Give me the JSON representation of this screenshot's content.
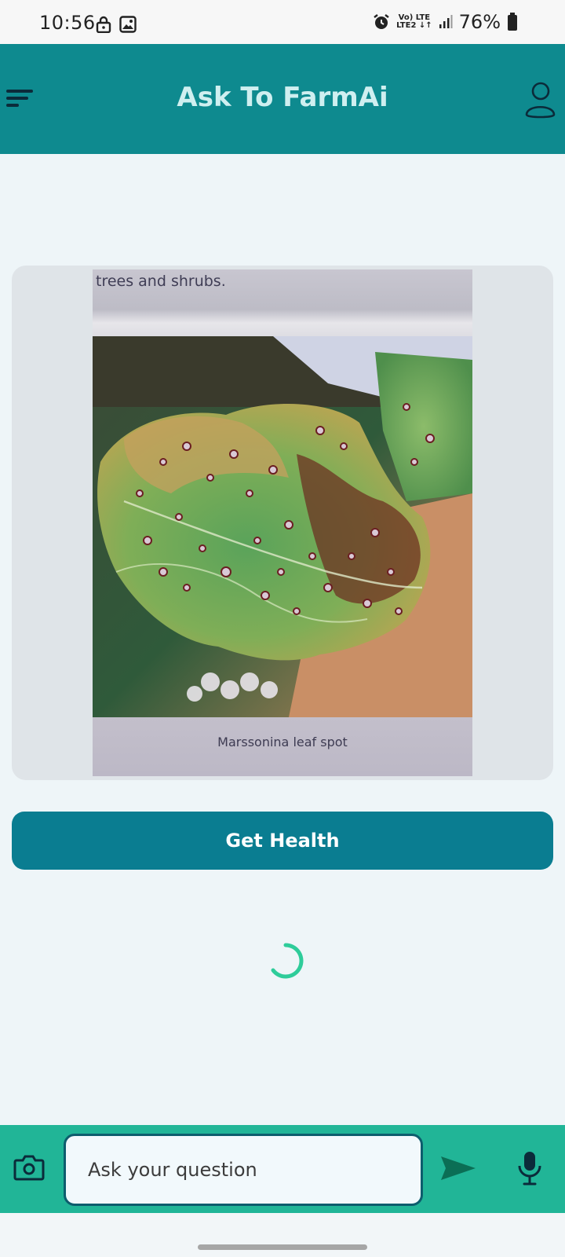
{
  "status_bar": {
    "time": "10:56",
    "network_top": "Vo) LTE",
    "network_bottom": "LTE2 ↓↑",
    "battery": "76%",
    "icons": [
      "lock-icon",
      "image-icon",
      "alarm-icon",
      "signal-icon",
      "battery-icon"
    ]
  },
  "app_bar": {
    "title": "Ask To FarmAi",
    "menu_icon": "menu-icon",
    "profile_icon": "person-icon"
  },
  "image_card": {
    "photo_top_text": "trees and shrubs.",
    "photo_caption": "Marssonina leaf spot"
  },
  "actions": {
    "get_health_label": "Get Health"
  },
  "loading": {
    "spinner_icon": "loading-spinner-icon",
    "color": "#2ecc9a"
  },
  "input_bar": {
    "placeholder": "Ask your question",
    "camera_icon": "camera-icon",
    "send_icon": "send-icon",
    "mic_icon": "microphone-icon"
  },
  "colors": {
    "app_bar": "#0e8a8f",
    "button": "#0a7d91",
    "input_bar": "#21b597",
    "background": "#eef5f8"
  }
}
